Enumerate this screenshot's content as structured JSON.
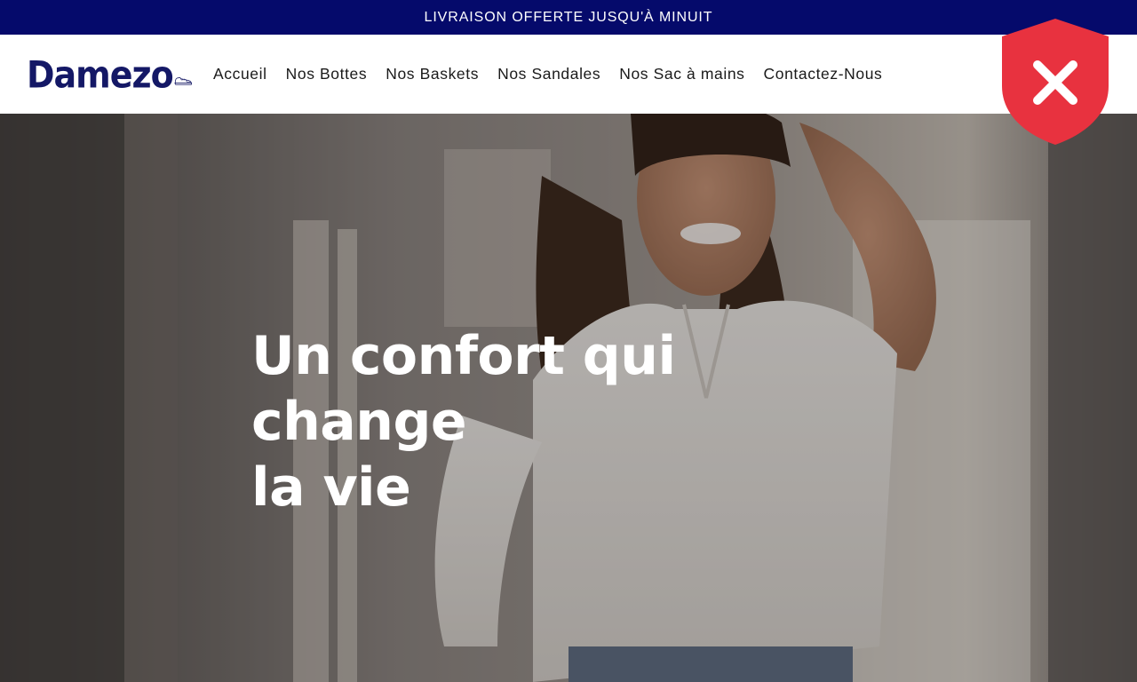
{
  "announcement": {
    "text": "LIVRAISON OFFERTE JUSQU'À MINUIT"
  },
  "header": {
    "logo_text": "Damezo",
    "logo_icon": "sneaker-icon",
    "nav": [
      {
        "label": "Accueil"
      },
      {
        "label": "Nos Bottes"
      },
      {
        "label": "Nos Baskets"
      },
      {
        "label": "Nos Sandales"
      },
      {
        "label": "Nos Sac à mains"
      },
      {
        "label": "Contactez-Nous"
      }
    ]
  },
  "badge": {
    "icon": "shield-close-icon",
    "color": "#e8323f"
  },
  "hero": {
    "title_line1": "Un confort qui change",
    "title_line2": "la vie"
  },
  "colors": {
    "announcement_bg": "#050a6b",
    "logo": "#141866",
    "nav_text": "#1a1a1a",
    "hero_text": "#ffffff"
  }
}
